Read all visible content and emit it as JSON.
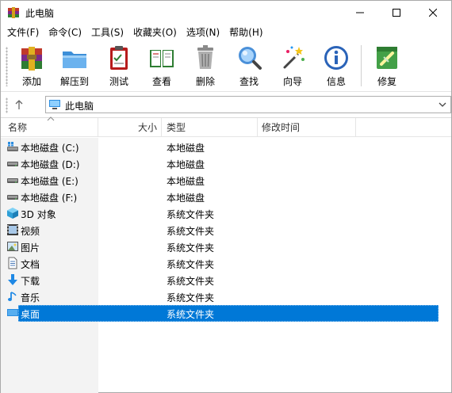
{
  "window": {
    "title": "此电脑"
  },
  "menu": [
    "文件(F)",
    "命令(C)",
    "工具(S)",
    "收藏夹(O)",
    "选项(N)",
    "帮助(H)"
  ],
  "toolbar": {
    "add": "添加",
    "extract": "解压到",
    "test": "测试",
    "view": "查看",
    "delete": "删除",
    "find": "查找",
    "wizard": "向导",
    "info": "信息",
    "repair": "修复"
  },
  "address": {
    "path": "此电脑"
  },
  "columns": {
    "name": "名称",
    "size": "大小",
    "type": "类型",
    "modified": "修改时间"
  },
  "rows": [
    {
      "name": "本地磁盘 (C:)",
      "type": "本地磁盘",
      "icon": "drive-windows-icon"
    },
    {
      "name": "本地磁盘 (D:)",
      "type": "本地磁盘",
      "icon": "drive-icon"
    },
    {
      "name": "本地磁盘 (E:)",
      "type": "本地磁盘",
      "icon": "drive-icon"
    },
    {
      "name": "本地磁盘 (F:)",
      "type": "本地磁盘",
      "icon": "drive-icon"
    },
    {
      "name": "3D 对象",
      "type": "系统文件夹",
      "icon": "cube-3d-icon"
    },
    {
      "name": "视频",
      "type": "系统文件夹",
      "icon": "video-icon"
    },
    {
      "name": "图片",
      "type": "系统文件夹",
      "icon": "picture-icon"
    },
    {
      "name": "文档",
      "type": "系统文件夹",
      "icon": "document-icon"
    },
    {
      "name": "下载",
      "type": "系统文件夹",
      "icon": "download-arrow-icon"
    },
    {
      "name": "音乐",
      "type": "系统文件夹",
      "icon": "music-note-icon"
    },
    {
      "name": "桌面",
      "type": "系统文件夹",
      "icon": "desktop-icon",
      "selected": true
    }
  ],
  "colors": {
    "selection": "#0078d7",
    "accent_blue": "#1e88e5"
  }
}
